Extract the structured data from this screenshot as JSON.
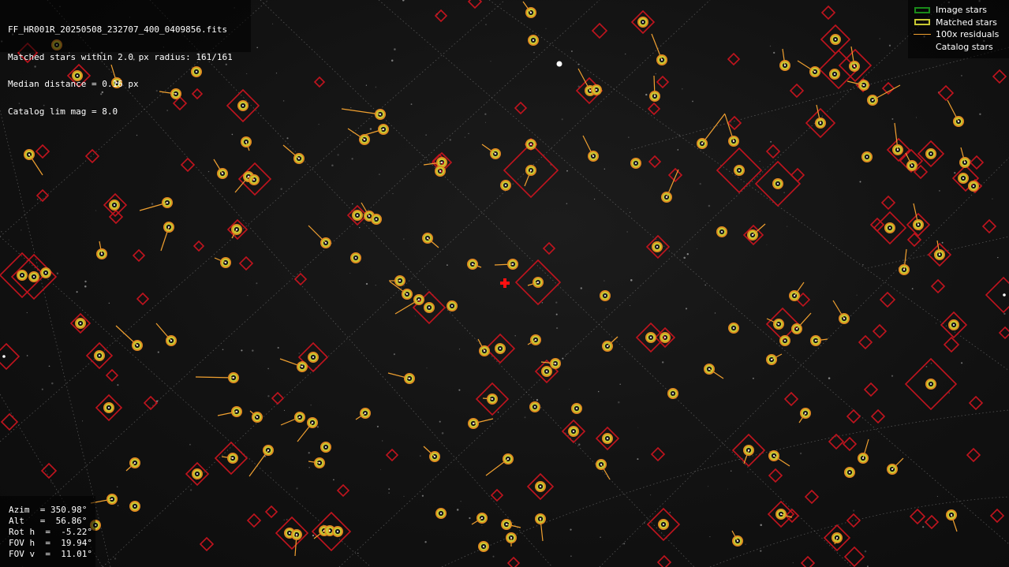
{
  "info": {
    "filename": "FF_HR001R_20250508_232707_400_0409856.fits",
    "matched": "Matched stars within 2.0 px radius: 161/161",
    "median": "Median distance = 0.16 px",
    "catalog": "Catalog lim mag = 8.0"
  },
  "legend": {
    "items": [
      {
        "label": "Image stars",
        "color": "#1a8a1a",
        "kind": "box"
      },
      {
        "label": "Matched stars",
        "color": "#c8c832",
        "kind": "box"
      },
      {
        "label": "100x residuals",
        "color": "#f0a030",
        "kind": "line"
      },
      {
        "label": "Catalog stars",
        "color": "#c0141e",
        "kind": "none"
      }
    ]
  },
  "pointing": {
    "azim": "Azim  = 350.98°",
    "alt": "Alt   =  56.86°",
    "rot": "Rot h  =  -5.22°",
    "fov_h": "FOV h  =  19.94°",
    "fov_v": "FOV v  =  11.01°"
  },
  "colors": {
    "catalog": "#c0141e",
    "matched_ring": "#c8c832",
    "image_ring": "#e08820",
    "residual": "#f0a030",
    "center_cross": "#ff1010",
    "grid": "#8a8a8a"
  }
}
